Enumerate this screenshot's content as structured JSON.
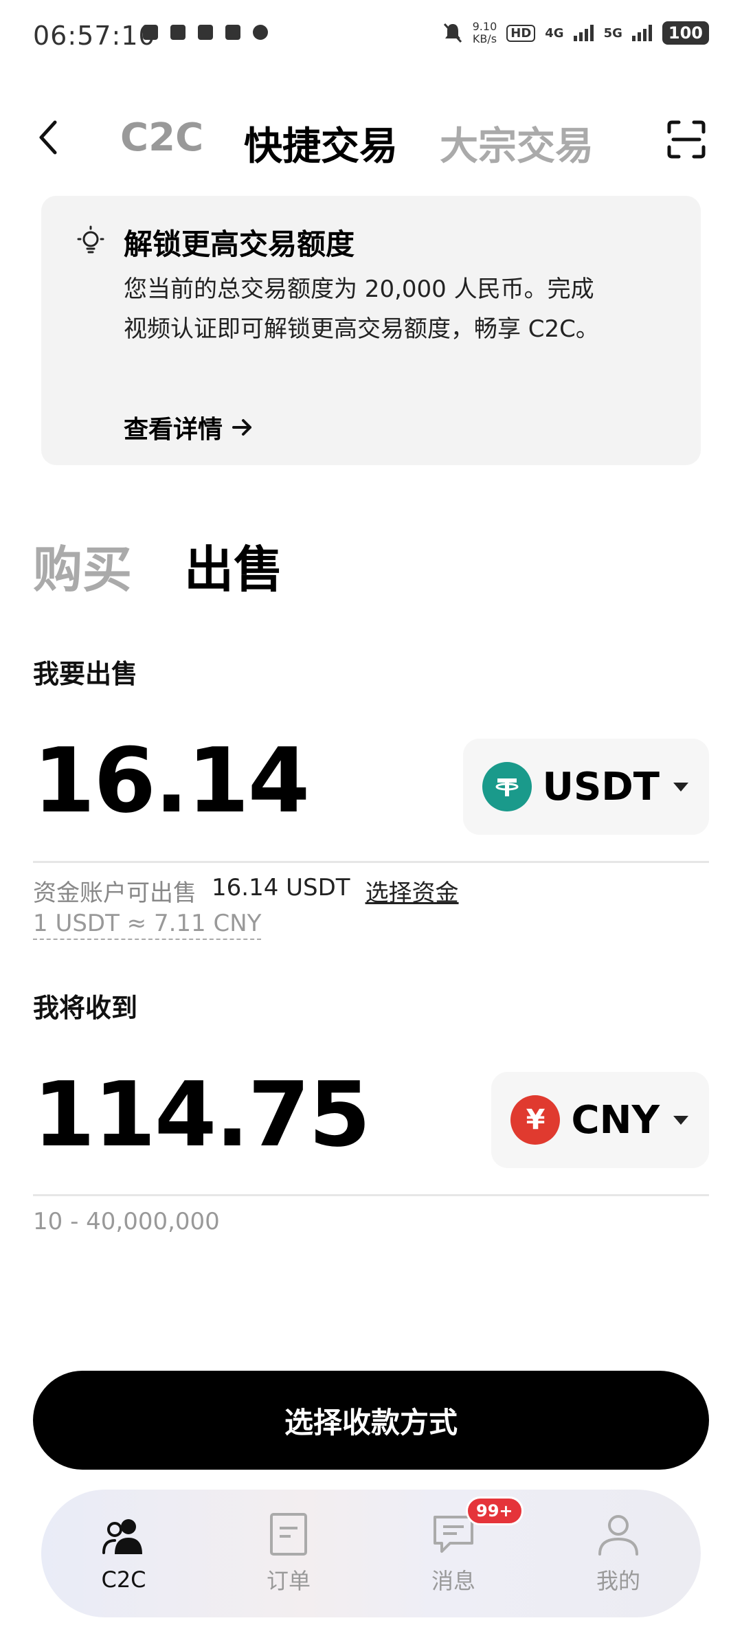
{
  "status_bar": {
    "time": "06:57:10",
    "net_speed_value": "9.10",
    "net_speed_unit": "KB/s",
    "hd_badge": "HD",
    "sim1": "4G",
    "sim2": "5G",
    "battery": "100"
  },
  "top_nav": {
    "tabs": [
      "C2C",
      "快捷交易",
      "大宗交易"
    ],
    "active_tab": "快捷交易"
  },
  "info_card": {
    "title": "解锁更高交易额度",
    "body": "您当前的总交易额度为 20,000 人民币。完成视频认证即可解锁更高交易额度，畅享 C2C。",
    "link": "查看详情"
  },
  "trade_tabs": {
    "buy": "购买",
    "sell": "出售",
    "active": "sell"
  },
  "sell_section": {
    "label": "我要出售",
    "amount": "16.14",
    "currency": "USDT",
    "available_label": "资金账户可出售",
    "available_value": "16.14 USDT",
    "select_funds": "选择资金",
    "rate": "1 USDT ≈ 7.11 CNY"
  },
  "receive_section": {
    "label": "我将收到",
    "amount": "114.75",
    "currency": "CNY",
    "currency_symbol": "¥",
    "range": "10 - 40,000,000"
  },
  "cta": {
    "label": "选择收款方式"
  },
  "bottom_nav": {
    "items": [
      {
        "label": "C2C",
        "icon": "users-icon"
      },
      {
        "label": "订单",
        "icon": "order-icon"
      },
      {
        "label": "消息",
        "icon": "message-icon"
      },
      {
        "label": "我的",
        "icon": "profile-icon"
      }
    ],
    "active": "C2C",
    "message_badge": "99+"
  },
  "colors": {
    "usdt": "#1a9a8b",
    "cny": "#e03a2f",
    "badge": "#e5343a"
  }
}
